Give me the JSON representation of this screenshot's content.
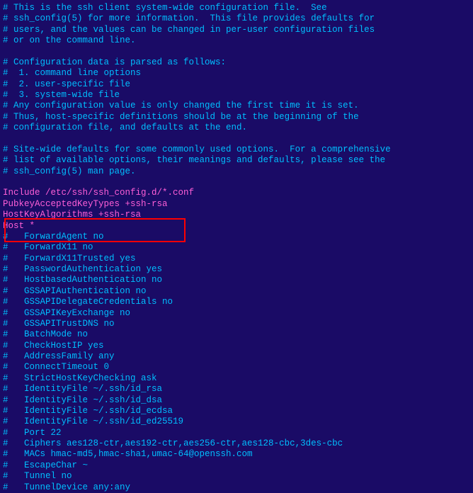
{
  "lines": [
    {
      "t": "comment",
      "v": "# This is the ssh client system-wide configuration file.  See"
    },
    {
      "t": "comment",
      "v": "# ssh_config(5) for more information.  This file provides defaults for"
    },
    {
      "t": "comment",
      "v": "# users, and the values can be changed in per-user configuration files"
    },
    {
      "t": "comment",
      "v": "# or on the command line."
    },
    {
      "t": "comment",
      "v": ""
    },
    {
      "t": "comment",
      "v": "# Configuration data is parsed as follows:"
    },
    {
      "t": "comment",
      "v": "#  1. command line options"
    },
    {
      "t": "comment",
      "v": "#  2. user-specific file"
    },
    {
      "t": "comment",
      "v": "#  3. system-wide file"
    },
    {
      "t": "comment",
      "v": "# Any configuration value is only changed the first time it is set."
    },
    {
      "t": "comment",
      "v": "# Thus, host-specific definitions should be at the beginning of the"
    },
    {
      "t": "comment",
      "v": "# configuration file, and defaults at the end."
    },
    {
      "t": "comment",
      "v": ""
    },
    {
      "t": "comment",
      "v": "# Site-wide defaults for some commonly used options.  For a comprehensive"
    },
    {
      "t": "comment",
      "v": "# list of available options, their meanings and defaults, please see the"
    },
    {
      "t": "comment",
      "v": "# ssh_config(5) man page."
    },
    {
      "t": "comment",
      "v": ""
    },
    {
      "t": "uncommented",
      "v": "Include /etc/ssh/ssh_config.d/*.conf"
    },
    {
      "t": "uncommented",
      "v": "PubkeyAcceptedKeyTypes +ssh-rsa"
    },
    {
      "t": "uncommented",
      "v": "HostKeyAlgorithms +ssh-rsa"
    },
    {
      "t": "uncommented",
      "v": "Host *"
    },
    {
      "t": "comment",
      "v": "#   ForwardAgent no"
    },
    {
      "t": "comment",
      "v": "#   ForwardX11 no"
    },
    {
      "t": "comment",
      "v": "#   ForwardX11Trusted yes"
    },
    {
      "t": "comment",
      "v": "#   PasswordAuthentication yes"
    },
    {
      "t": "comment",
      "v": "#   HostbasedAuthentication no"
    },
    {
      "t": "comment",
      "v": "#   GSSAPIAuthentication no"
    },
    {
      "t": "comment",
      "v": "#   GSSAPIDelegateCredentials no"
    },
    {
      "t": "comment",
      "v": "#   GSSAPIKeyExchange no"
    },
    {
      "t": "comment",
      "v": "#   GSSAPITrustDNS no"
    },
    {
      "t": "comment",
      "v": "#   BatchMode no"
    },
    {
      "t": "comment",
      "v": "#   CheckHostIP yes"
    },
    {
      "t": "comment",
      "v": "#   AddressFamily any"
    },
    {
      "t": "comment",
      "v": "#   ConnectTimeout 0"
    },
    {
      "t": "comment",
      "v": "#   StrictHostKeyChecking ask"
    },
    {
      "t": "comment",
      "v": "#   IdentityFile ~/.ssh/id_rsa"
    },
    {
      "t": "comment",
      "v": "#   IdentityFile ~/.ssh/id_dsa"
    },
    {
      "t": "comment",
      "v": "#   IdentityFile ~/.ssh/id_ecdsa"
    },
    {
      "t": "comment",
      "v": "#   IdentityFile ~/.ssh/id_ed25519"
    },
    {
      "t": "comment",
      "v": "#   Port 22"
    },
    {
      "t": "comment",
      "v": "#   Ciphers aes128-ctr,aes192-ctr,aes256-ctr,aes128-cbc,3des-cbc"
    },
    {
      "t": "comment",
      "v": "#   MACs hmac-md5,hmac-sha1,umac-64@openssh.com"
    },
    {
      "t": "comment",
      "v": "#   EscapeChar ~"
    },
    {
      "t": "comment",
      "v": "#   Tunnel no"
    },
    {
      "t": "comment",
      "v": "#   TunnelDevice any:any"
    }
  ]
}
